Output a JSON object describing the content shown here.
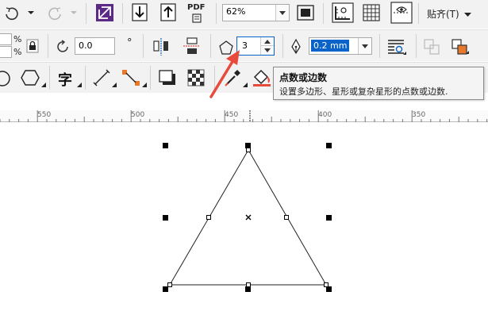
{
  "toolbar1": {
    "zoom_value": "62%",
    "pdf_label": "PDF",
    "snap_label": "贴齐(T)"
  },
  "toolbar2": {
    "pct_1": "%",
    "pct_2": "%",
    "rotation_value": "0.0",
    "degree_symbol": "°",
    "points_value": "3",
    "outline_width_value": "0.2 mm"
  },
  "toolbar3": {
    "text_tool_glyph": "字"
  },
  "tooltip": {
    "title": "点数或边数",
    "body": "设置多边形、星形或复杂星形的点数或边数."
  },
  "ruler": {
    "labels": [
      "550",
      "500",
      "450",
      "400",
      "350"
    ]
  },
  "colors": {
    "toolbar_bg": "#f2f2f2",
    "accent_purple": "#5b2a86",
    "selected_blue": "#0a63c9",
    "arrow_red": "#e84a3c"
  }
}
